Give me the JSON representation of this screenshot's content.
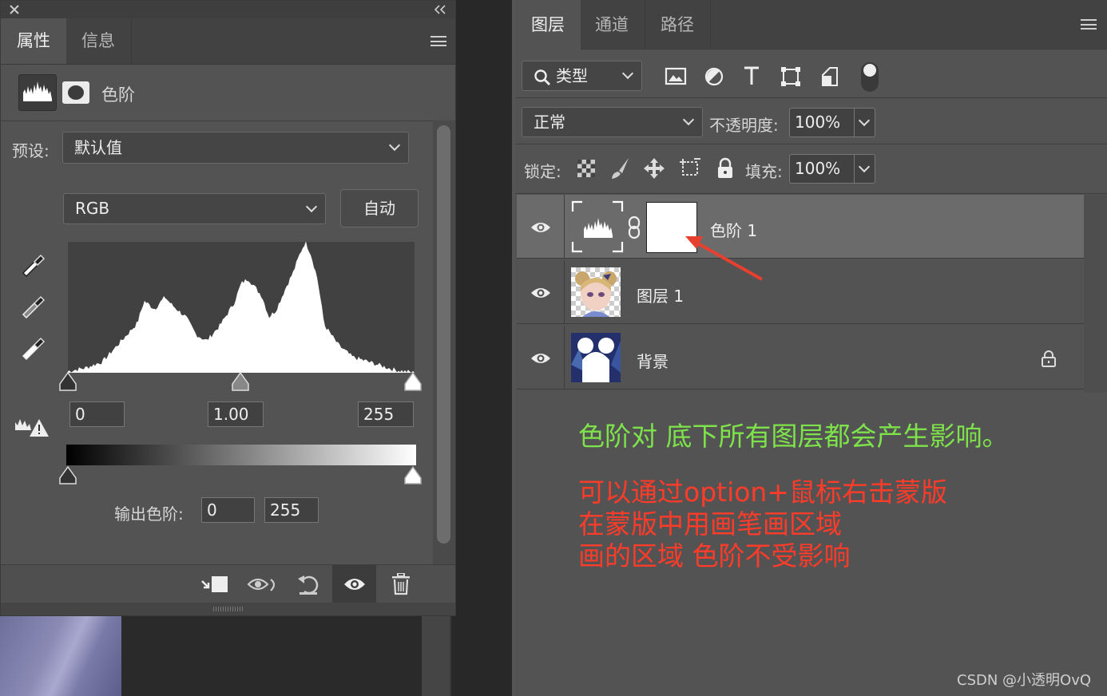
{
  "colors": {
    "panel_bg": "#535353",
    "tab_bg": "#424242",
    "selected_row": "#6b6b6b",
    "note_green": "#7ee34a",
    "note_red": "#ff3b2a",
    "arrow_red": "#e8402f"
  },
  "properties": {
    "close_icon": "close-icon",
    "collapse_icon": "double-chevron-left-icon",
    "tabs": [
      {
        "label": "属性"
      },
      {
        "label": "信息"
      }
    ],
    "header_title": "色阶",
    "preset_label": "预设:",
    "preset_value": "默认值",
    "channel_value": "RGB",
    "auto_button": "自动",
    "input_black": "0",
    "input_mid": "1.00",
    "input_white": "255",
    "output_label": "输出色阶:",
    "output_black": "0",
    "output_white": "255",
    "bottom_icons": [
      "clip-to-layer-icon",
      "toggle-view-icon",
      "reset-icon",
      "visibility-icon",
      "trash-icon"
    ]
  },
  "layers_panel": {
    "tabs": [
      {
        "label": "图层"
      },
      {
        "label": "通道"
      },
      {
        "label": "路径"
      }
    ],
    "filter_value": "类型",
    "blend_mode": "正常",
    "opacity_label": "不透明度:",
    "opacity_value": "100%",
    "lock_label": "锁定:",
    "fill_label": "填充:",
    "fill_value": "100%",
    "layers": [
      {
        "name": "色阶 1",
        "visible": true,
        "selected": true
      },
      {
        "name": "图层 1",
        "visible": true,
        "selected": false
      },
      {
        "name": "背景",
        "visible": true,
        "locked": true,
        "selected": false
      }
    ],
    "annotation_green": "色阶对 底下所有图层都会产生影响。",
    "annotation_red": [
      "可以通过option+鼠标右击蒙版",
      "在蒙版中用画笔画区域",
      "画的区域 色阶不受影响"
    ],
    "watermark": "CSDN @小透明OvQ"
  }
}
